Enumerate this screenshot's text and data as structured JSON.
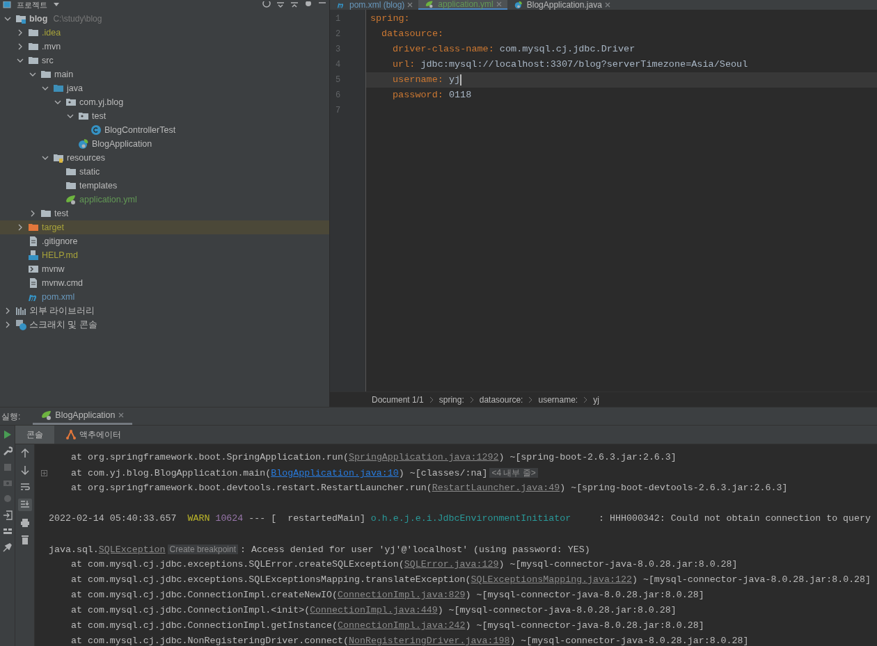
{
  "project_panel": {
    "title": "프로젝트",
    "tree": [
      {
        "label": "blog",
        "hint": "C:\\study\\blog",
        "kind": "module",
        "expanded": true,
        "selected": false,
        "color": "#bbbbbb",
        "children": [
          {
            "label": ".idea",
            "kind": "folder",
            "expanded": false,
            "selected": false,
            "color": "#a8a33a"
          },
          {
            "label": ".mvn",
            "kind": "folder",
            "expanded": false,
            "selected": false,
            "color": "#bbbbbb"
          },
          {
            "label": "src",
            "kind": "folder",
            "expanded": true,
            "selected": false,
            "color": "#bbbbbb",
            "children": [
              {
                "label": "main",
                "kind": "folder",
                "expanded": true,
                "selected": false,
                "color": "#bbbbbb",
                "children": [
                  {
                    "label": "java",
                    "kind": "source",
                    "expanded": true,
                    "selected": false,
                    "color": "#bbbbbb",
                    "children": [
                      {
                        "label": "com.yj.blog",
                        "kind": "package",
                        "expanded": true,
                        "selected": false,
                        "color": "#bbbbbb",
                        "children": [
                          {
                            "label": "test",
                            "kind": "package",
                            "expanded": true,
                            "selected": false,
                            "color": "#bbbbbb",
                            "children": [
                              {
                                "label": "BlogControllerTest",
                                "kind": "class",
                                "selected": false,
                                "color": "#bbbbbb"
                              }
                            ]
                          },
                          {
                            "label": "BlogApplication",
                            "kind": "spring",
                            "selected": false,
                            "color": "#bbbbbb"
                          }
                        ]
                      }
                    ]
                  },
                  {
                    "label": "resources",
                    "kind": "resources",
                    "expanded": true,
                    "selected": false,
                    "color": "#bbbbbb",
                    "children": [
                      {
                        "label": "static",
                        "kind": "folder",
                        "selected": false,
                        "color": "#bbbbbb"
                      },
                      {
                        "label": "templates",
                        "kind": "folder",
                        "selected": false,
                        "color": "#bbbbbb"
                      },
                      {
                        "label": "application.yml",
                        "kind": "yml",
                        "selected": false,
                        "color": "#629755"
                      }
                    ]
                  }
                ]
              },
              {
                "label": "test",
                "kind": "folder",
                "expanded": false,
                "selected": false,
                "color": "#bbbbbb"
              }
            ]
          },
          {
            "label": "target",
            "kind": "excluded",
            "expanded": false,
            "selected": true,
            "color": "#a8a33a"
          },
          {
            "label": ".gitignore",
            "kind": "file",
            "selected": false,
            "color": "#bbbbbb"
          },
          {
            "label": "HELP.md",
            "kind": "md",
            "selected": false,
            "color": "#a8a33a"
          },
          {
            "label": "mvnw",
            "kind": "shell",
            "selected": false,
            "color": "#bbbbbb"
          },
          {
            "label": "mvnw.cmd",
            "kind": "file",
            "selected": false,
            "color": "#bbbbbb"
          },
          {
            "label": "pom.xml",
            "kind": "maven",
            "selected": false,
            "color": "#6897bb"
          }
        ]
      },
      {
        "label": "외부 라이브러리",
        "kind": "libraries",
        "expanded": false,
        "selected": false,
        "color": "#bbbbbb"
      },
      {
        "label": "스크래치 및 콘솔",
        "kind": "scratches",
        "expanded": false,
        "selected": false,
        "color": "#bbbbbb"
      }
    ]
  },
  "editor": {
    "tabs": [
      {
        "label": "pom.xml (blog)",
        "kind": "maven",
        "selected": false,
        "color": "#6897bb"
      },
      {
        "label": "application.yml",
        "kind": "yml",
        "selected": true,
        "color": "#629755"
      },
      {
        "label": "BlogApplication.java",
        "kind": "spring",
        "selected": false,
        "color": "#bbbbbb"
      }
    ],
    "line_numbers": [
      "1",
      "2",
      "3",
      "4",
      "5",
      "6",
      "7"
    ],
    "yaml": [
      {
        "key": "spring:",
        "current": false,
        "children": [
          {
            "key": "datasource:",
            "current": false,
            "children": [
              {
                "key": "driver-class-name:",
                "value": "com.mysql.cj.jdbc.Driver",
                "current": false
              },
              {
                "key": "url:",
                "value": "jdbc:mysql://localhost:3307/blog?serverTimezone=Asia/Seoul",
                "current": false
              },
              {
                "key": "username:",
                "value": "yj",
                "current": true
              },
              {
                "key": "password:",
                "value": "0118",
                "current": false
              }
            ]
          }
        ]
      }
    ],
    "breadcrumb": [
      "Document 1/1",
      "spring:",
      "datasource:",
      "username:",
      "yj"
    ]
  },
  "run_panel": {
    "title": "실행:",
    "tabs": [
      {
        "label": "BlogApplication",
        "selected": true
      }
    ],
    "subtabs": [
      {
        "label": "콘솔",
        "selected": true
      },
      {
        "label": "액추에이터",
        "selected": false
      }
    ],
    "console": [
      {
        "indent": true,
        "folded": false,
        "parts": [
          {
            "kind": "text",
            "text": "at org.springframework.boot.SpringApplication.run("
          },
          {
            "kind": "link",
            "text": "SpringApplication.java:1292"
          },
          {
            "kind": "text",
            "text": ") ~[spring-boot-2.6.3.jar:2.6.3]"
          }
        ]
      },
      {
        "indent": true,
        "folded": true,
        "parts": [
          {
            "kind": "text",
            "text": "at com.yj.blog.BlogApplication.main("
          },
          {
            "kind": "project_link",
            "text": "BlogApplication.java:10"
          },
          {
            "kind": "text",
            "text": ") ~[classes/:na]"
          },
          {
            "kind": "hint",
            "text": "<4 내부 줄>"
          }
        ]
      },
      {
        "indent": true,
        "folded": false,
        "parts": [
          {
            "kind": "text",
            "text": "at org.springframework.boot.devtools.restart.RestartLauncher.run("
          },
          {
            "kind": "link",
            "text": "RestartLauncher.java:49"
          },
          {
            "kind": "text",
            "text": ") ~[spring-boot-devtools-2.6.3.jar:2.6.3]"
          }
        ]
      },
      {
        "folded": false
      },
      {
        "indent": false,
        "folded": false,
        "parts": [
          {
            "kind": "text",
            "text": "2022-02-14 05:40:33.657  "
          },
          {
            "kind": "warn",
            "text": "WARN"
          },
          {
            "kind": "pid",
            "text": "10624"
          },
          {
            "kind": "text",
            "text": "--- [  restartedMain] "
          },
          {
            "kind": "logger",
            "text": "o.h.e.j.e.i.JdbcEnvironmentInitiator"
          },
          {
            "kind": "text",
            "text": "     : HHH000342: Could not obtain connection to query"
          }
        ]
      },
      {
        "folded": false
      },
      {
        "indent": false,
        "folded": false,
        "parts": [
          {
            "kind": "text",
            "text": "java.sql."
          },
          {
            "kind": "link",
            "text": "SQLException"
          },
          {
            "kind": "hint",
            "text": "Create breakpoint"
          },
          {
            "kind": "text",
            "text": ": Access denied for user 'yj'@'localhost' (using password: YES)"
          }
        ]
      },
      {
        "indent": true,
        "folded": false,
        "parts": [
          {
            "kind": "text",
            "text": "at com.mysql.cj.jdbc.exceptions.SQLError.createSQLException("
          },
          {
            "kind": "link",
            "text": "SQLError.java:129"
          },
          {
            "kind": "text",
            "text": ") ~[mysql-connector-java-8.0.28.jar:8.0.28]"
          }
        ]
      },
      {
        "indent": true,
        "folded": false,
        "parts": [
          {
            "kind": "text",
            "text": "at com.mysql.cj.jdbc.exceptions.SQLExceptionsMapping.translateException("
          },
          {
            "kind": "link",
            "text": "SQLExceptionsMapping.java:122"
          },
          {
            "kind": "text",
            "text": ") ~[mysql-connector-java-8.0.28.jar:8.0.28]"
          }
        ]
      },
      {
        "indent": true,
        "folded": false,
        "parts": [
          {
            "kind": "text",
            "text": "at com.mysql.cj.jdbc.ConnectionImpl.createNewIO("
          },
          {
            "kind": "link",
            "text": "ConnectionImpl.java:829"
          },
          {
            "kind": "text",
            "text": ") ~[mysql-connector-java-8.0.28.jar:8.0.28]"
          }
        ]
      },
      {
        "indent": true,
        "folded": false,
        "parts": [
          {
            "kind": "text",
            "text": "at com.mysql.cj.jdbc.ConnectionImpl.<init>("
          },
          {
            "kind": "link",
            "text": "ConnectionImpl.java:449"
          },
          {
            "kind": "text",
            "text": ") ~[mysql-connector-java-8.0.28.jar:8.0.28]"
          }
        ]
      },
      {
        "indent": true,
        "folded": false,
        "parts": [
          {
            "kind": "text",
            "text": "at com.mysql.cj.jdbc.ConnectionImpl.getInstance("
          },
          {
            "kind": "link",
            "text": "ConnectionImpl.java:242"
          },
          {
            "kind": "text",
            "text": ") ~[mysql-connector-java-8.0.28.jar:8.0.28]"
          }
        ]
      },
      {
        "indent": true,
        "folded": false,
        "parts": [
          {
            "kind": "text",
            "text": "at com.mysql.cj.jdbc.NonRegisteringDriver.connect("
          },
          {
            "kind": "link",
            "text": "NonRegisteringDriver.java:198"
          },
          {
            "kind": "text",
            "text": ") ~[mysql-connector-java-8.0.28.jar:8.0.28]"
          }
        ]
      }
    ]
  }
}
